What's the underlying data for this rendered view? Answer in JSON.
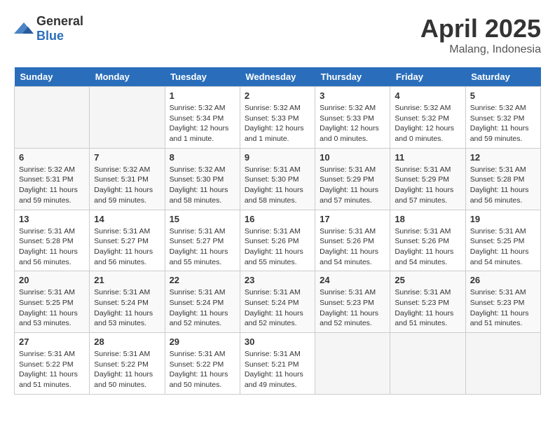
{
  "logo": {
    "general": "General",
    "blue": "Blue"
  },
  "title": {
    "month": "April 2025",
    "location": "Malang, Indonesia"
  },
  "weekdays": [
    "Sunday",
    "Monday",
    "Tuesday",
    "Wednesday",
    "Thursday",
    "Friday",
    "Saturday"
  ],
  "weeks": [
    [
      {
        "day": "",
        "sunrise": "",
        "sunset": "",
        "daylight": ""
      },
      {
        "day": "",
        "sunrise": "",
        "sunset": "",
        "daylight": ""
      },
      {
        "day": "1",
        "sunrise": "Sunrise: 5:32 AM",
        "sunset": "Sunset: 5:34 PM",
        "daylight": "Daylight: 12 hours and 1 minute."
      },
      {
        "day": "2",
        "sunrise": "Sunrise: 5:32 AM",
        "sunset": "Sunset: 5:33 PM",
        "daylight": "Daylight: 12 hours and 1 minute."
      },
      {
        "day": "3",
        "sunrise": "Sunrise: 5:32 AM",
        "sunset": "Sunset: 5:33 PM",
        "daylight": "Daylight: 12 hours and 0 minutes."
      },
      {
        "day": "4",
        "sunrise": "Sunrise: 5:32 AM",
        "sunset": "Sunset: 5:32 PM",
        "daylight": "Daylight: 12 hours and 0 minutes."
      },
      {
        "day": "5",
        "sunrise": "Sunrise: 5:32 AM",
        "sunset": "Sunset: 5:32 PM",
        "daylight": "Daylight: 11 hours and 59 minutes."
      }
    ],
    [
      {
        "day": "6",
        "sunrise": "Sunrise: 5:32 AM",
        "sunset": "Sunset: 5:31 PM",
        "daylight": "Daylight: 11 hours and 59 minutes."
      },
      {
        "day": "7",
        "sunrise": "Sunrise: 5:32 AM",
        "sunset": "Sunset: 5:31 PM",
        "daylight": "Daylight: 11 hours and 59 minutes."
      },
      {
        "day": "8",
        "sunrise": "Sunrise: 5:32 AM",
        "sunset": "Sunset: 5:30 PM",
        "daylight": "Daylight: 11 hours and 58 minutes."
      },
      {
        "day": "9",
        "sunrise": "Sunrise: 5:31 AM",
        "sunset": "Sunset: 5:30 PM",
        "daylight": "Daylight: 11 hours and 58 minutes."
      },
      {
        "day": "10",
        "sunrise": "Sunrise: 5:31 AM",
        "sunset": "Sunset: 5:29 PM",
        "daylight": "Daylight: 11 hours and 57 minutes."
      },
      {
        "day": "11",
        "sunrise": "Sunrise: 5:31 AM",
        "sunset": "Sunset: 5:29 PM",
        "daylight": "Daylight: 11 hours and 57 minutes."
      },
      {
        "day": "12",
        "sunrise": "Sunrise: 5:31 AM",
        "sunset": "Sunset: 5:28 PM",
        "daylight": "Daylight: 11 hours and 56 minutes."
      }
    ],
    [
      {
        "day": "13",
        "sunrise": "Sunrise: 5:31 AM",
        "sunset": "Sunset: 5:28 PM",
        "daylight": "Daylight: 11 hours and 56 minutes."
      },
      {
        "day": "14",
        "sunrise": "Sunrise: 5:31 AM",
        "sunset": "Sunset: 5:27 PM",
        "daylight": "Daylight: 11 hours and 56 minutes."
      },
      {
        "day": "15",
        "sunrise": "Sunrise: 5:31 AM",
        "sunset": "Sunset: 5:27 PM",
        "daylight": "Daylight: 11 hours and 55 minutes."
      },
      {
        "day": "16",
        "sunrise": "Sunrise: 5:31 AM",
        "sunset": "Sunset: 5:26 PM",
        "daylight": "Daylight: 11 hours and 55 minutes."
      },
      {
        "day": "17",
        "sunrise": "Sunrise: 5:31 AM",
        "sunset": "Sunset: 5:26 PM",
        "daylight": "Daylight: 11 hours and 54 minutes."
      },
      {
        "day": "18",
        "sunrise": "Sunrise: 5:31 AM",
        "sunset": "Sunset: 5:26 PM",
        "daylight": "Daylight: 11 hours and 54 minutes."
      },
      {
        "day": "19",
        "sunrise": "Sunrise: 5:31 AM",
        "sunset": "Sunset: 5:25 PM",
        "daylight": "Daylight: 11 hours and 54 minutes."
      }
    ],
    [
      {
        "day": "20",
        "sunrise": "Sunrise: 5:31 AM",
        "sunset": "Sunset: 5:25 PM",
        "daylight": "Daylight: 11 hours and 53 minutes."
      },
      {
        "day": "21",
        "sunrise": "Sunrise: 5:31 AM",
        "sunset": "Sunset: 5:24 PM",
        "daylight": "Daylight: 11 hours and 53 minutes."
      },
      {
        "day": "22",
        "sunrise": "Sunrise: 5:31 AM",
        "sunset": "Sunset: 5:24 PM",
        "daylight": "Daylight: 11 hours and 52 minutes."
      },
      {
        "day": "23",
        "sunrise": "Sunrise: 5:31 AM",
        "sunset": "Sunset: 5:24 PM",
        "daylight": "Daylight: 11 hours and 52 minutes."
      },
      {
        "day": "24",
        "sunrise": "Sunrise: 5:31 AM",
        "sunset": "Sunset: 5:23 PM",
        "daylight": "Daylight: 11 hours and 52 minutes."
      },
      {
        "day": "25",
        "sunrise": "Sunrise: 5:31 AM",
        "sunset": "Sunset: 5:23 PM",
        "daylight": "Daylight: 11 hours and 51 minutes."
      },
      {
        "day": "26",
        "sunrise": "Sunrise: 5:31 AM",
        "sunset": "Sunset: 5:23 PM",
        "daylight": "Daylight: 11 hours and 51 minutes."
      }
    ],
    [
      {
        "day": "27",
        "sunrise": "Sunrise: 5:31 AM",
        "sunset": "Sunset: 5:22 PM",
        "daylight": "Daylight: 11 hours and 51 minutes."
      },
      {
        "day": "28",
        "sunrise": "Sunrise: 5:31 AM",
        "sunset": "Sunset: 5:22 PM",
        "daylight": "Daylight: 11 hours and 50 minutes."
      },
      {
        "day": "29",
        "sunrise": "Sunrise: 5:31 AM",
        "sunset": "Sunset: 5:22 PM",
        "daylight": "Daylight: 11 hours and 50 minutes."
      },
      {
        "day": "30",
        "sunrise": "Sunrise: 5:31 AM",
        "sunset": "Sunset: 5:21 PM",
        "daylight": "Daylight: 11 hours and 49 minutes."
      },
      {
        "day": "",
        "sunrise": "",
        "sunset": "",
        "daylight": ""
      },
      {
        "day": "",
        "sunrise": "",
        "sunset": "",
        "daylight": ""
      },
      {
        "day": "",
        "sunrise": "",
        "sunset": "",
        "daylight": ""
      }
    ]
  ]
}
